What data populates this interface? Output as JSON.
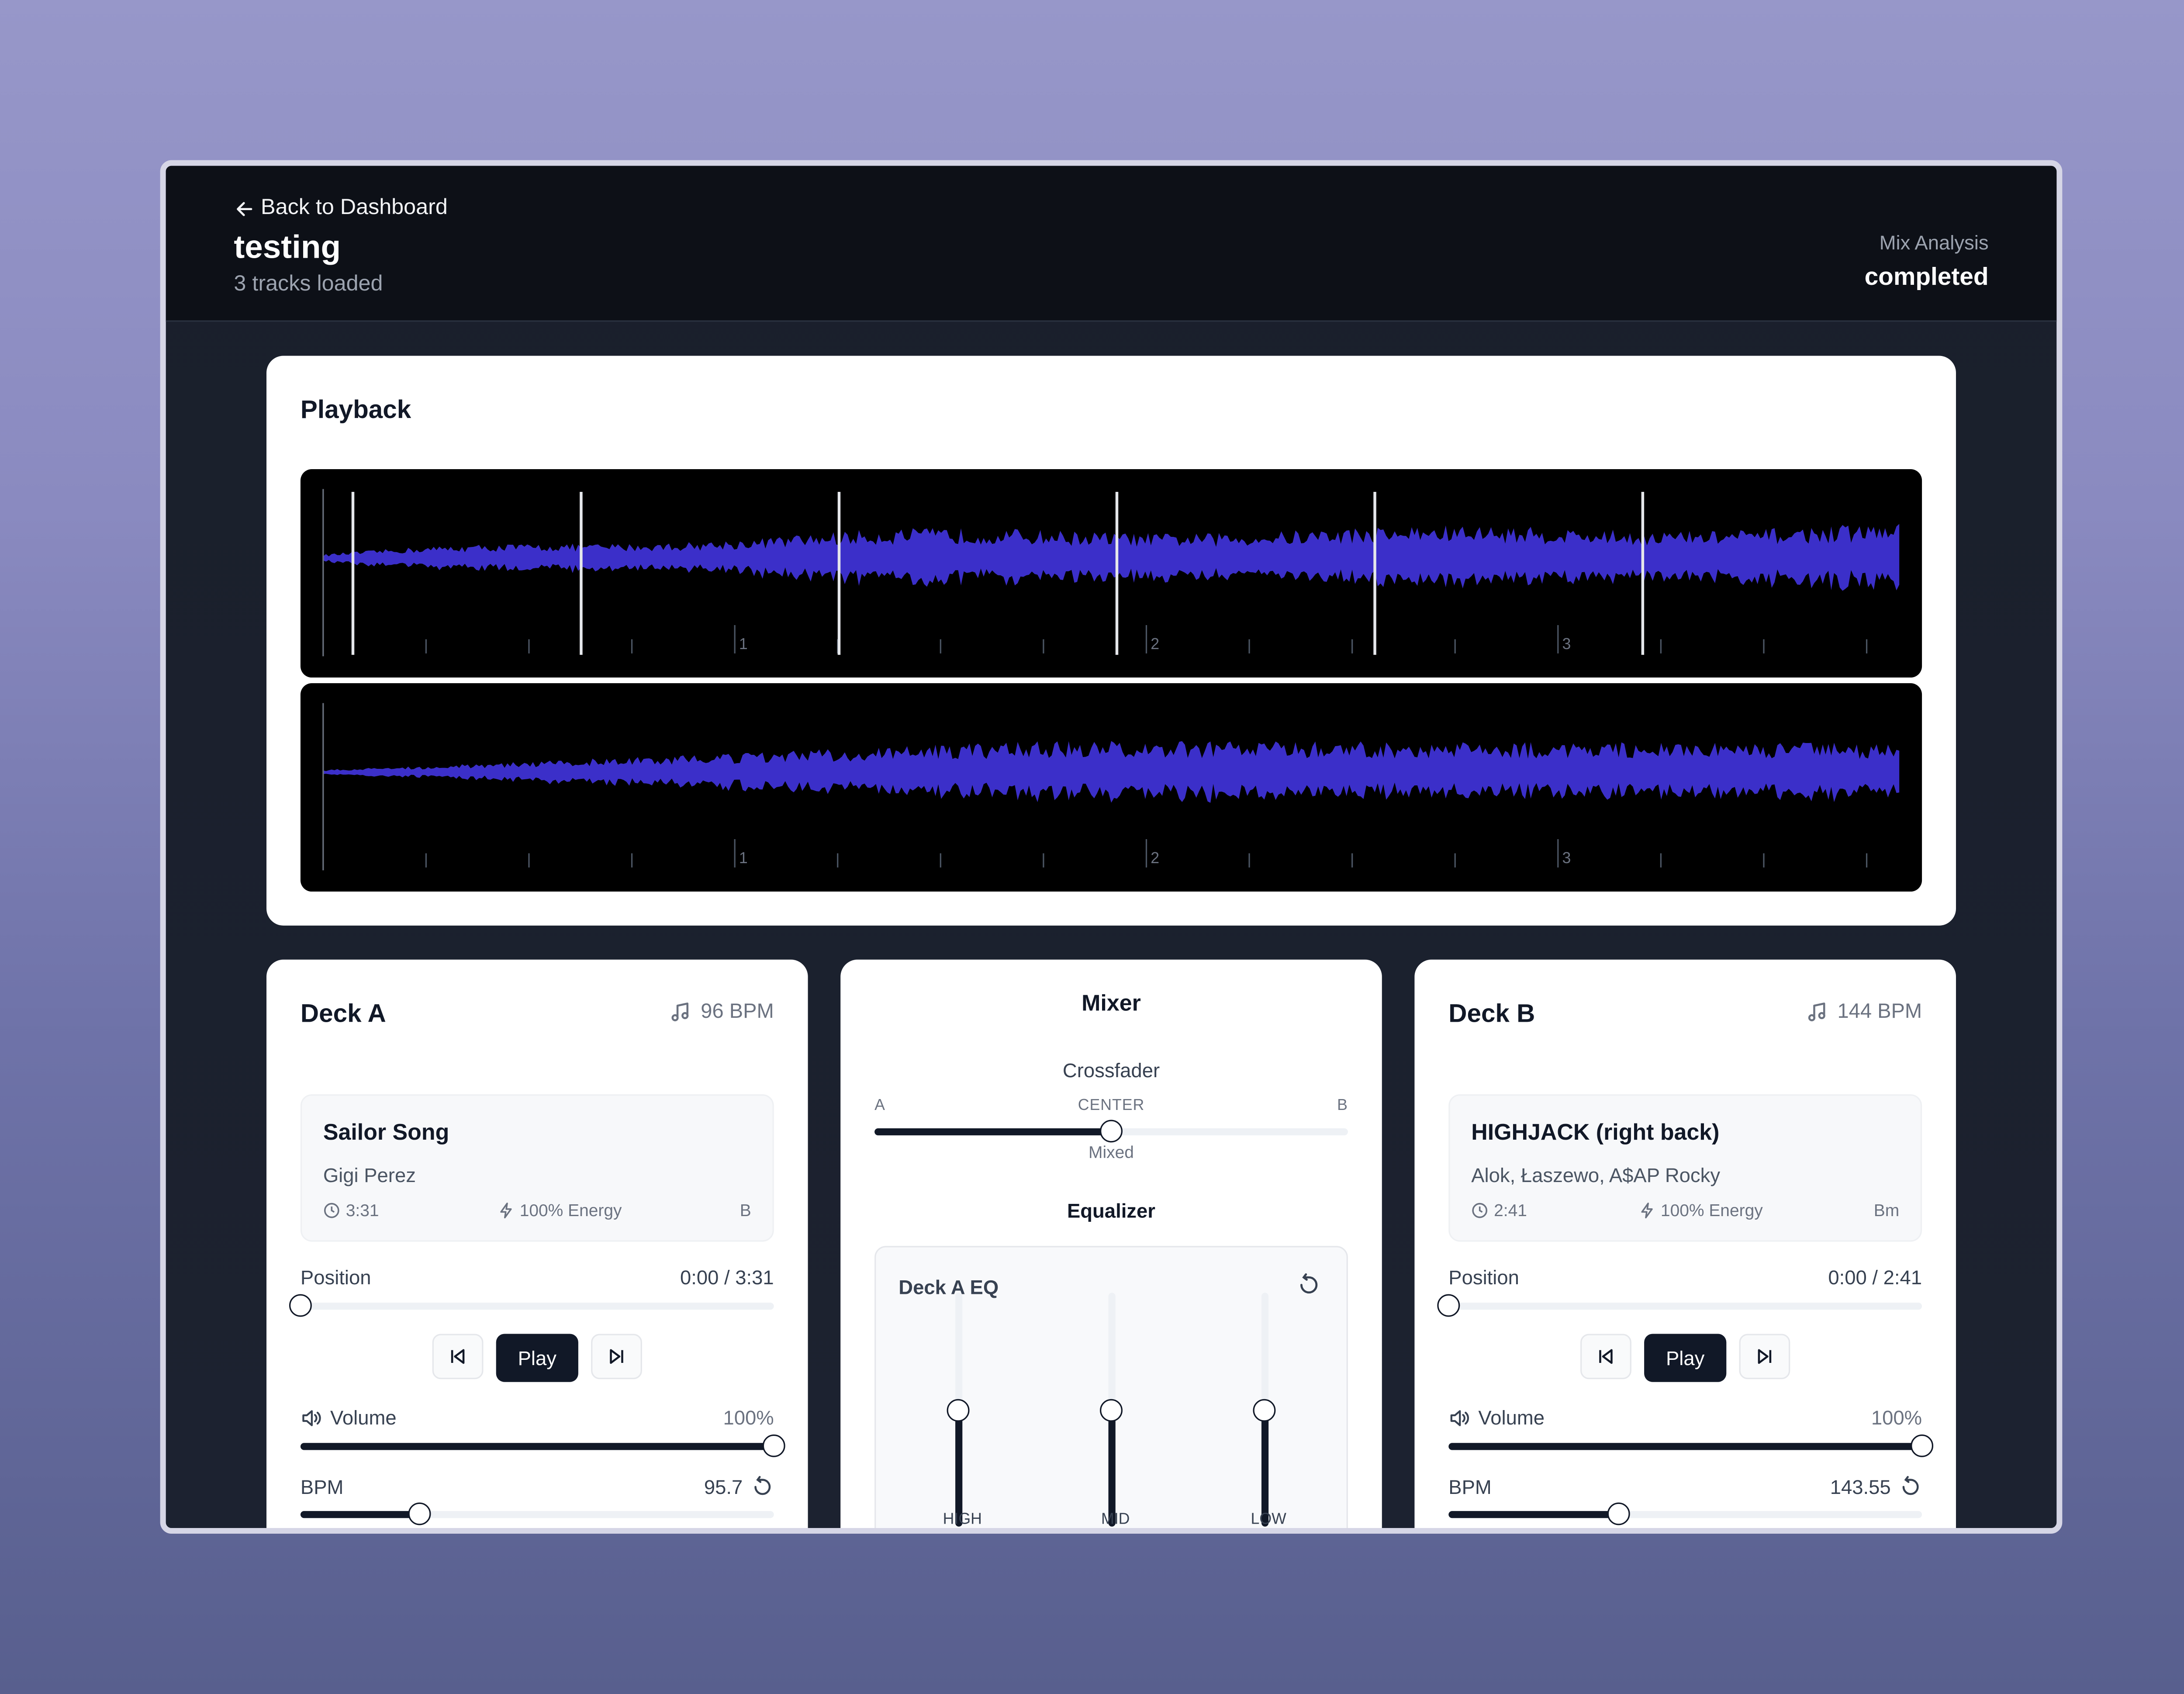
{
  "header": {
    "back_label": "Back to Dashboard",
    "mix_name": "testing",
    "tracks_loaded": "3 tracks loaded",
    "status_label": "Mix Analysis",
    "status_value": "completed"
  },
  "playback": {
    "title": "Playback",
    "waveform_color": "#3b2fc9",
    "timeline_markers": [
      "1",
      "2",
      "3"
    ]
  },
  "deck_a": {
    "title": "Deck A",
    "bpm_display": "96 BPM",
    "track": {
      "title": "Sailor Song",
      "artist": "Gigi Perez",
      "duration": "3:31",
      "energy": "100% Energy",
      "key": "B"
    },
    "position_label": "Position",
    "position_value": "0:00 / 3:31",
    "position_fraction": 0,
    "play_label": "Play",
    "volume_label": "Volume",
    "volume_value": "100%",
    "volume_fraction": 1.0,
    "bpm_label": "BPM",
    "bpm_value": "95.7",
    "bpm_fraction": 0.25
  },
  "mixer": {
    "title": "Mixer",
    "crossfader_label": "Crossfader",
    "crossfader_left": "A",
    "crossfader_center": "CENTER",
    "crossfader_right": "B",
    "crossfader_state": "Mixed",
    "crossfader_fraction": 0.5,
    "equalizer_label": "Equalizer",
    "eq_title": "Deck A EQ",
    "bands": [
      {
        "label": "HIGH",
        "fraction": 0.5
      },
      {
        "label": "MID",
        "fraction": 0.5
      },
      {
        "label": "LOW",
        "fraction": 0.5
      }
    ]
  },
  "deck_b": {
    "title": "Deck B",
    "bpm_display": "144 BPM",
    "track": {
      "title": "HIGHJACK (right back)",
      "artist": "Alok, Łaszewo, A$AP Rocky",
      "duration": "2:41",
      "energy": "100% Energy",
      "key": "Bm"
    },
    "position_label": "Position",
    "position_value": "0:00 / 2:41",
    "position_fraction": 0,
    "play_label": "Play",
    "volume_label": "Volume",
    "volume_value": "100%",
    "volume_fraction": 1.0,
    "bpm_label": "BPM",
    "bpm_value": "143.55",
    "bpm_fraction": 0.36
  }
}
